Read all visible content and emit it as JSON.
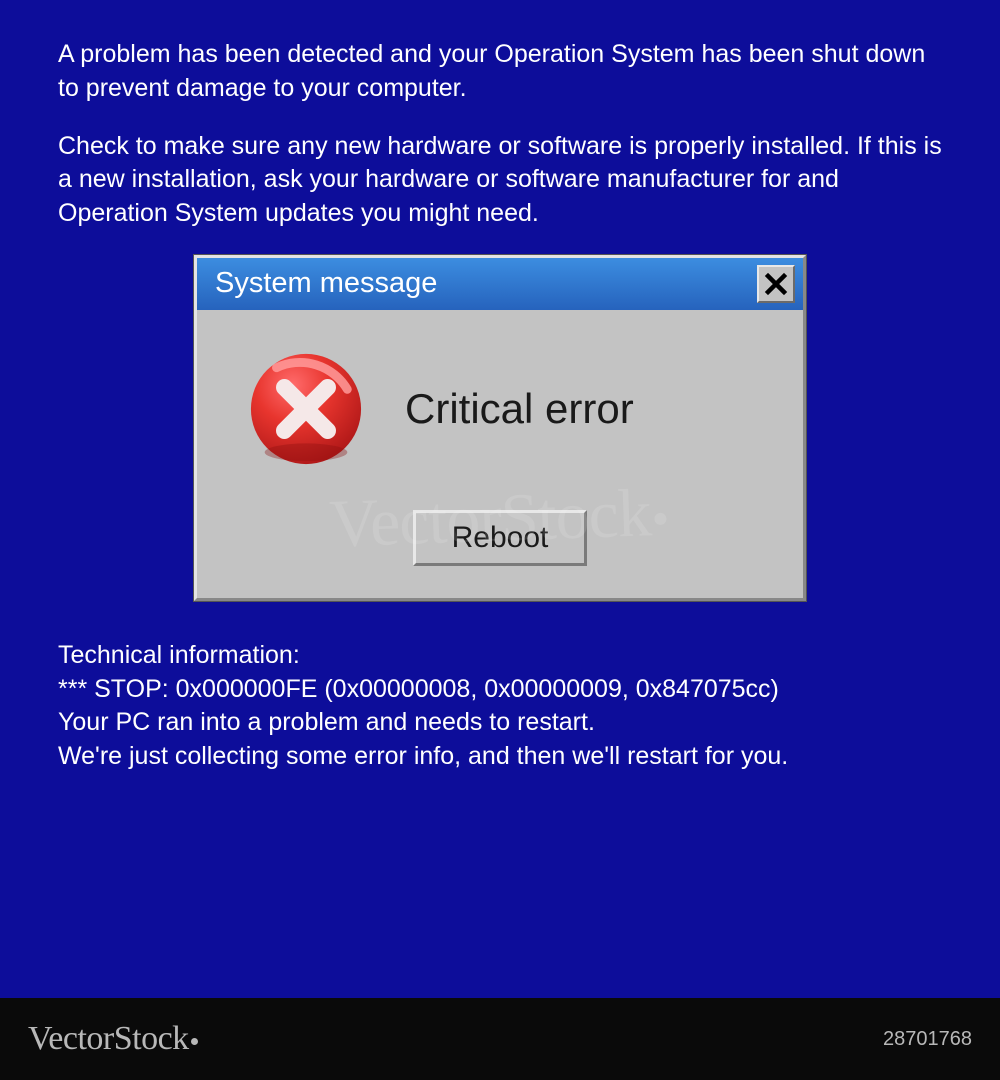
{
  "bsod": {
    "para1": "A problem has been detected and your Operation System has been shut down to prevent damage to your computer.",
    "para2": "Check to make sure any new hardware or software is properly installed. If this is a new installation, ask your hardware or software manufacturer for and Operation System updates you might need."
  },
  "dialog": {
    "title": "System message",
    "message": "Critical error",
    "button_label": "Reboot"
  },
  "tech": {
    "heading": "Technical information:",
    "stop_line": "*** STOP: 0x000000FE (0x00000008, 0x00000009, 0x847075cc)",
    "line3": "Your PC ran into a problem and needs to restart.",
    "line4": "We're just collecting some error info, and then we'll restart for you."
  },
  "watermark": {
    "brand": "VectorStock",
    "id": "28701768"
  }
}
